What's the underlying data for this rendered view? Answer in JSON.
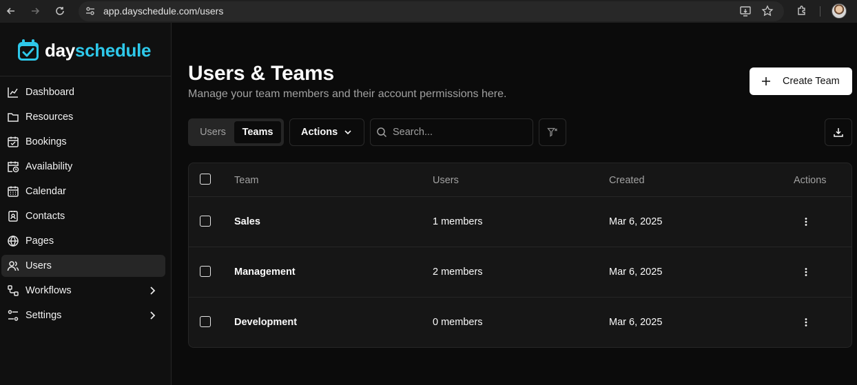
{
  "browser": {
    "url": "app.dayschedule.com/users"
  },
  "sidebar": {
    "logo": {
      "word_day": "day",
      "word_schedule": "schedule"
    },
    "items": [
      {
        "label": "Dashboard",
        "icon": "chart-line-icon"
      },
      {
        "label": "Resources",
        "icon": "folder-icon"
      },
      {
        "label": "Bookings",
        "icon": "calendar-check-icon"
      },
      {
        "label": "Availability",
        "icon": "calendar-clock-icon"
      },
      {
        "label": "Calendar",
        "icon": "calendar-grid-icon"
      },
      {
        "label": "Contacts",
        "icon": "contact-card-icon"
      },
      {
        "label": "Pages",
        "icon": "globe-icon"
      },
      {
        "label": "Users",
        "icon": "users-icon",
        "active": true
      },
      {
        "label": "Workflows",
        "icon": "workflow-icon",
        "has_submenu": true
      },
      {
        "label": "Settings",
        "icon": "sliders-icon",
        "has_submenu": true
      }
    ]
  },
  "header": {
    "title": "Users & Teams",
    "subtitle": "Manage your team members and their account permissions here.",
    "create_button": "Create Team"
  },
  "toolbar": {
    "tabs": [
      {
        "label": "Users",
        "active": false
      },
      {
        "label": "Teams",
        "active": true
      }
    ],
    "actions_label": "Actions",
    "search": {
      "placeholder": "Search...",
      "value": ""
    }
  },
  "table": {
    "columns": [
      "Team",
      "Users",
      "Created",
      "Actions"
    ],
    "rows": [
      {
        "team": "Sales",
        "users": "1 members",
        "created": "Mar 6, 2025"
      },
      {
        "team": "Management",
        "users": "2 members",
        "created": "Mar 6, 2025"
      },
      {
        "team": "Development",
        "users": "0 members",
        "created": "Mar 6, 2025"
      }
    ]
  },
  "colors": {
    "brand_accent": "#2ec8ea",
    "background": "#0b0b0b",
    "sidebar": "#101010",
    "active_nav": "#262626"
  }
}
